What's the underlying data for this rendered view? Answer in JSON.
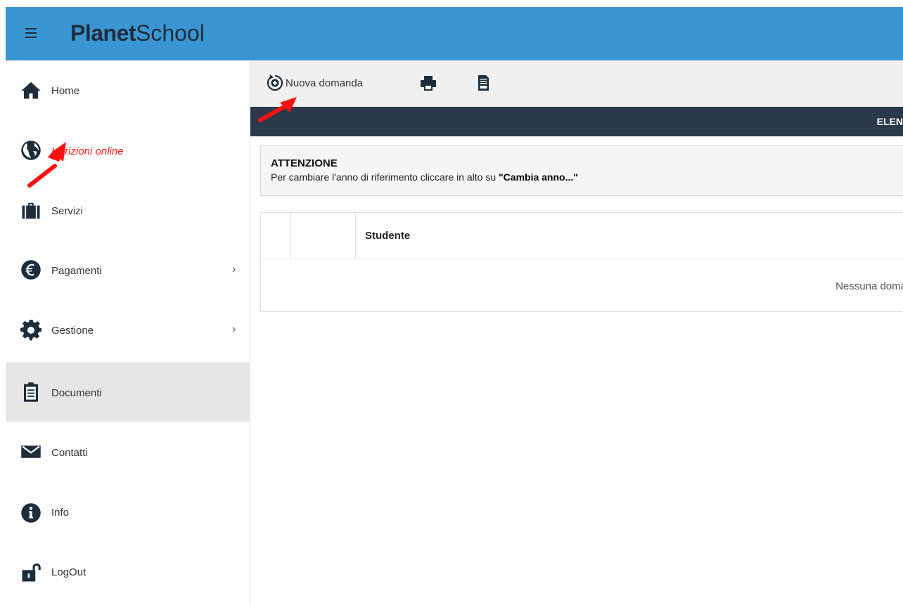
{
  "header": {
    "brand_bold": "Planet",
    "brand_regular": "School"
  },
  "sidebar": {
    "items": [
      {
        "label": "Home",
        "icon": "home-icon"
      },
      {
        "label": "Iscrizioni online",
        "icon": "globe-icon"
      },
      {
        "label": "Servizi",
        "icon": "briefcase-icon"
      },
      {
        "label": "Pagamenti",
        "icon": "euro-icon"
      },
      {
        "label": "Gestione",
        "icon": "gear-icon"
      },
      {
        "label": "Documenti",
        "icon": "clipboard-icon"
      },
      {
        "label": "Contatti",
        "icon": "envelope-icon"
      },
      {
        "label": "Info",
        "icon": "info-icon"
      },
      {
        "label": "LogOut",
        "icon": "unlock-icon"
      }
    ],
    "chevron": "›"
  },
  "toolbar": {
    "new_label": "Nuova domanda"
  },
  "section": {
    "title": "ELEN"
  },
  "alert": {
    "title": "ATTENZIONE",
    "text_before": "Per cambiare l'anno di riferimento cliccare in alto su ",
    "text_bold": "\"Cambia anno...\""
  },
  "table": {
    "header_student": "Studente",
    "empty_text": "Nessuna doma"
  },
  "colors": {
    "header_blue": "#3a96d2",
    "dark_bar": "#2b3a4a",
    "highlight_red": "#ff1a1a",
    "active_row": "#e6e6e6"
  }
}
